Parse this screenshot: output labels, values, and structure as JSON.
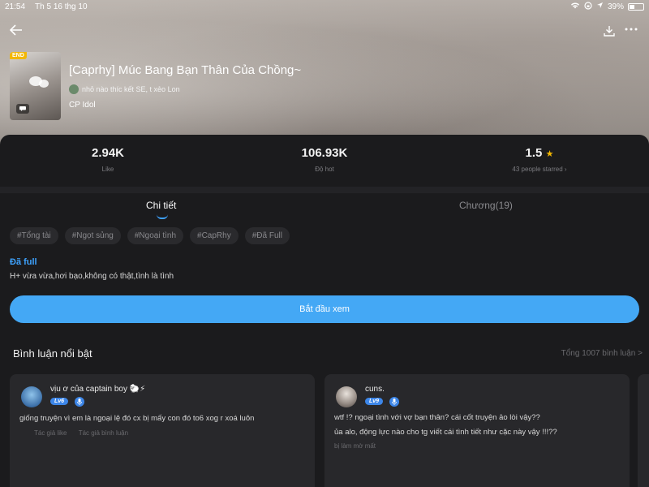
{
  "status_bar": {
    "time": "21:54",
    "date": "Th 5 16 thg 10",
    "battery": "39%"
  },
  "book": {
    "badge": "END",
    "title": "[Caprhy] Múc Bang Bạn Thân Của Chồng~",
    "author": "nhỏ nào thíc kết SE, t xẻo Lon",
    "category": "CP Idol"
  },
  "stats": {
    "likes": {
      "value": "2.94K",
      "label": "Like"
    },
    "hot": {
      "value": "106.93K",
      "label": "Độ hot"
    },
    "rating": {
      "value": "1.5",
      "label": "43 people starred ›"
    }
  },
  "tabs": [
    {
      "label": "Chi tiết",
      "active": true
    },
    {
      "label": "Chương(19)",
      "active": false
    }
  ],
  "tags": [
    "#Tổng tài",
    "#Ngọt sủng",
    "#Ngoại tình",
    "#CapRhy",
    "#Đã Full"
  ],
  "status": "Đã full",
  "description": "H+ vừa vừa,hơi bạo,không có thật,tình là tình",
  "start_button": "Bắt đầu xem",
  "comments": {
    "title": "Bình luận nổi bật",
    "total": "Tổng 1007 bình luận >",
    "items": [
      {
        "username": "vịu ơ của captain boy 🐑⚡",
        "level": "Lv6",
        "text": "giống truyện vì em là ngoại lệ đó cx bị mấy con đó to6 xog r xoá luôn",
        "meta1": "Tác giả like",
        "meta2": "Tác giả bình luận"
      },
      {
        "username": "cuns.",
        "level": "Lv9",
        "text1": "wtf !? ngoại tình với vợ bạn thân? cái cốt truyện ảo lòi vậy??",
        "text2": "ủa alo, động lực nào cho tg viết cái tình tiết như cặc này vậy !!!??",
        "meta1": "bị làm mờ mất"
      }
    ]
  },
  "colors": {
    "accent": "#44a8f5",
    "background": "#1b1b1d",
    "card": "#28282b",
    "star": "#f5b800",
    "end_badge": "#f2b705"
  }
}
